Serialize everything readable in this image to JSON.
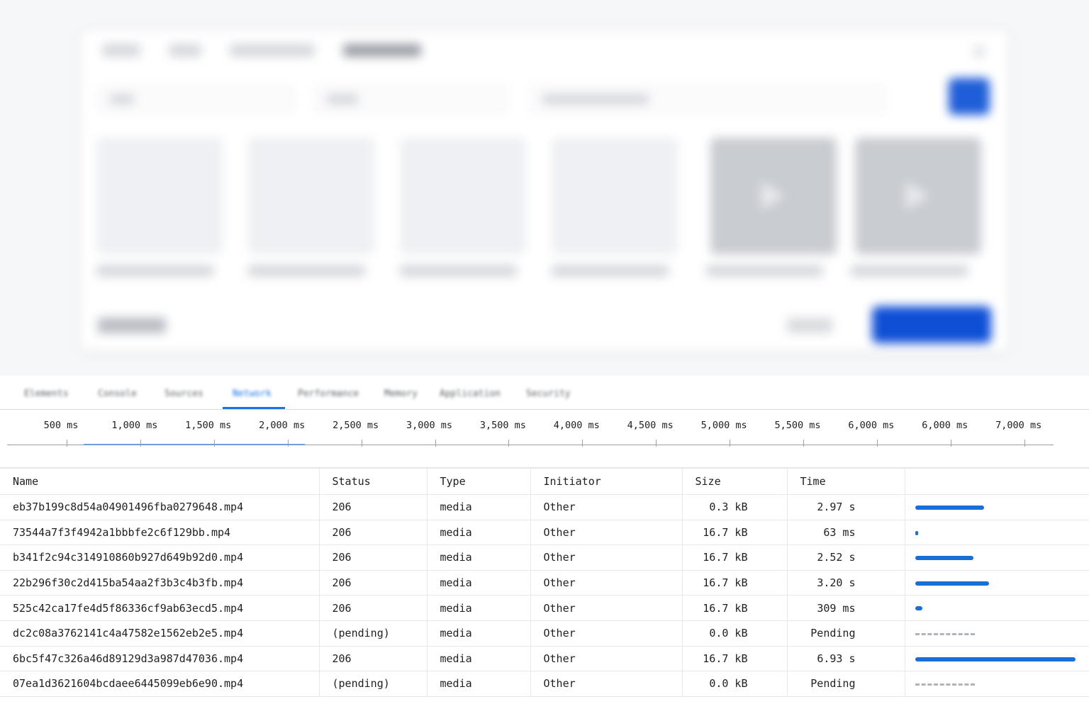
{
  "devtools": {
    "tabs": [
      {
        "label": "Elements"
      },
      {
        "label": "Console"
      },
      {
        "label": "Sources"
      },
      {
        "label": "Network",
        "active": true
      },
      {
        "label": "Performance"
      },
      {
        "label": "Memory"
      },
      {
        "label": "Application"
      },
      {
        "label": "Security"
      }
    ]
  },
  "timeline": {
    "ticks": [
      "500 ms",
      "1,000 ms",
      "1,500 ms",
      "2,000 ms",
      "2,500 ms",
      "3,000 ms",
      "3,500 ms",
      "4,000 ms",
      "4,500 ms",
      "5,000 ms",
      "5,500 ms",
      "6,000 ms",
      "6,000 ms",
      "7,000 ms"
    ]
  },
  "network": {
    "columns": {
      "name": "Name",
      "status": "Status",
      "type": "Type",
      "initiator": "Initiator",
      "size": "Size",
      "time": "Time"
    },
    "rows": [
      {
        "name": "eb37b199c8d54a04901496fba0279648.mp4",
        "status": "206",
        "type": "media",
        "initiator": "Other",
        "size": "0.3 kB",
        "time": "2.97 s",
        "duration_ms": 2970,
        "pending": false
      },
      {
        "name": "73544a7f3f4942a1bbbfe2c6f129bb.mp4",
        "status": "206",
        "type": "media",
        "initiator": "Other",
        "size": "16.7 kB",
        "time": "63 ms",
        "duration_ms": 63,
        "pending": false
      },
      {
        "name": "b341f2c94c314910860b927d649b92d0.mp4",
        "status": "206",
        "type": "media",
        "initiator": "Other",
        "size": "16.7 kB",
        "time": "2.52 s",
        "duration_ms": 2520,
        "pending": false
      },
      {
        "name": "22b296f30c2d415ba54aa2f3b3c4b3fb.mp4",
        "status": "206",
        "type": "media",
        "initiator": "Other",
        "size": "16.7 kB",
        "time": "3.20 s",
        "duration_ms": 3200,
        "pending": false
      },
      {
        "name": "525c42ca17fe4d5f86336cf9ab63ecd5.mp4",
        "status": "206",
        "type": "media",
        "initiator": "Other",
        "size": "16.7 kB",
        "time": "309 ms",
        "duration_ms": 309,
        "pending": false
      },
      {
        "name": "dc2c08a3762141c4a47582e1562eb2e5.mp4",
        "status": "(pending)",
        "type": "media",
        "initiator": "Other",
        "size": "0.0 kB",
        "time": "Pending",
        "duration_ms": null,
        "pending": true
      },
      {
        "name": "6bc5f47c326a46d89129d3a987d47036.mp4",
        "status": "206",
        "type": "media",
        "initiator": "Other",
        "size": "16.7 kB",
        "time": "6.93 s",
        "duration_ms": 6930,
        "pending": false
      },
      {
        "name": "07ea1d3621604bcdaee6445099eb6e90.mp4",
        "status": "(pending)",
        "type": "media",
        "initiator": "Other",
        "size": "0.0 kB",
        "time": "Pending",
        "duration_ms": null,
        "pending": true
      }
    ]
  },
  "colors": {
    "accent": "#1a73e8",
    "waterfall_bar": "#1a6fd6",
    "pending_status": "#e37400"
  }
}
